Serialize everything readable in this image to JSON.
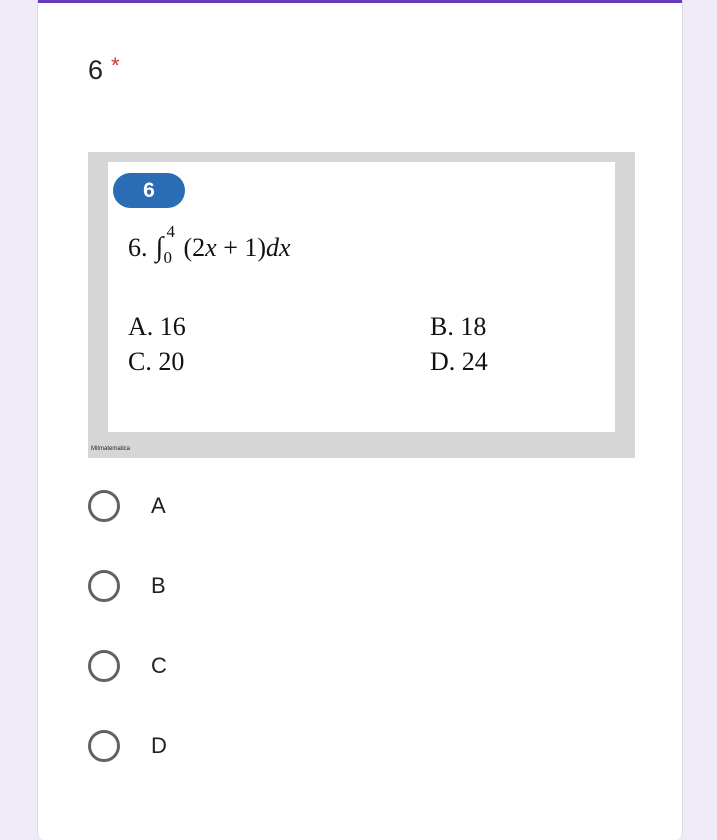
{
  "question": {
    "number": "6",
    "required_marker": "*"
  },
  "image": {
    "badge": "6",
    "problem_number": "6.",
    "integral_upper": "4",
    "integral_lower": "0",
    "integrand_a": "(2",
    "integrand_x": "x",
    "integrand_b": " + 1)",
    "integrand_d": "dx",
    "options": {
      "a": "A. 16",
      "b": "B. 18",
      "c": "C. 20",
      "d": "D. 24"
    },
    "watermark": "Mitmatematica"
  },
  "choices": [
    {
      "label": "A"
    },
    {
      "label": "B"
    },
    {
      "label": "C"
    },
    {
      "label": "D"
    }
  ],
  "colors": {
    "accent": "#673ab7",
    "required": "#d93025",
    "badge": "#2a6db5"
  }
}
